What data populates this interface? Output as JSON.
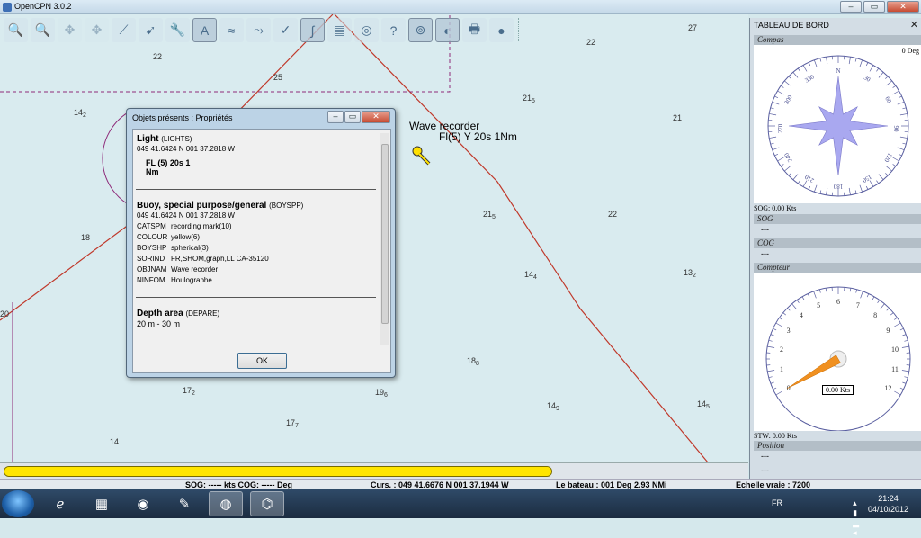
{
  "window": {
    "title": "OpenCPN 3.0.2"
  },
  "toolbar": {
    "tools": [
      {
        "name": "zoom-in-icon",
        "glyph": "🔍"
      },
      {
        "name": "zoom-out-icon",
        "glyph": "🔍"
      },
      {
        "name": "scale-in-icon",
        "glyph": "✥"
      },
      {
        "name": "scale-out-icon",
        "glyph": "✥"
      },
      {
        "name": "route-icon",
        "glyph": "⟋"
      },
      {
        "name": "follow-ship-icon",
        "glyph": "➹"
      },
      {
        "name": "settings-icon",
        "glyph": "🔧"
      },
      {
        "name": "text-icon",
        "glyph": "A"
      },
      {
        "name": "chart-tide-icon",
        "glyph": "≈"
      },
      {
        "name": "current-icon",
        "glyph": "⤳"
      },
      {
        "name": "quilt-icon",
        "glyph": "✓"
      },
      {
        "name": "track-icon",
        "glyph": "∫"
      },
      {
        "name": "layers-icon",
        "glyph": "▤"
      },
      {
        "name": "mob-icon",
        "glyph": "◎"
      },
      {
        "name": "help-icon",
        "glyph": "?"
      },
      {
        "name": "dashboard-icon",
        "glyph": "⊚"
      },
      {
        "name": "globe-icon",
        "glyph": "◐"
      },
      {
        "name": "print-icon",
        "glyph": "🖶"
      },
      {
        "name": "about-icon",
        "glyph": "●"
      }
    ]
  },
  "chart": {
    "soundings": [
      {
        "v": "22",
        "s": ""
      },
      {
        "v": "27",
        "s": ""
      },
      {
        "v": "22",
        "s": ""
      },
      {
        "v": "25",
        "s": ""
      },
      {
        "v": "21",
        "s": "5"
      },
      {
        "v": "14",
        "s": "2"
      },
      {
        "v": "21",
        "s": ""
      },
      {
        "v": "21",
        "s": "5"
      },
      {
        "v": "22",
        "s": ""
      },
      {
        "v": "18",
        "s": ""
      },
      {
        "v": "14",
        "s": "4"
      },
      {
        "v": "13",
        "s": "2"
      },
      {
        "v": "18",
        "s": "8"
      },
      {
        "v": "17",
        "s": "2"
      },
      {
        "v": "19",
        "s": "6"
      },
      {
        "v": "14",
        "s": "9"
      },
      {
        "v": "14",
        "s": "5"
      },
      {
        "v": "17",
        "s": "7"
      },
      {
        "v": "14",
        "s": ""
      },
      {
        "v": "20",
        "s": ""
      }
    ],
    "wave_label": "Wave recorder",
    "light_label": "Fl(5) Y 20s 1Nm"
  },
  "dialog": {
    "title": "Objets présents : Propriétés",
    "light": {
      "name": "Light",
      "code": "(LIGHTS)",
      "position": "049 41.6424 N 001 37.2818 W",
      "fl_line1": "FL (5) 20s 1",
      "fl_line2": "Nm"
    },
    "buoy": {
      "name": "Buoy, special purpose/general",
      "code": "(BOYSPP)",
      "position": "049 41.6424 N 001 37.2818 W",
      "attrs": [
        {
          "k": "CATSPM",
          "v": "recording mark(10)"
        },
        {
          "k": "COLOUR",
          "v": "yellow(6)"
        },
        {
          "k": "BOYSHP",
          "v": "spherical(3)"
        },
        {
          "k": "SORIND",
          "v": "FR,SHOM,graph,LL CA-35120"
        },
        {
          "k": "OBJNAM",
          "v": "Wave recorder"
        },
        {
          "k": "NINFOM",
          "v": "Houlographe"
        }
      ]
    },
    "depth": {
      "name": "Depth area",
      "code": "(DEPARE)",
      "range": "20 m - 30 m"
    },
    "ok_label": "OK"
  },
  "dashboard": {
    "title": "TABLEAU DE BORD",
    "compass": {
      "label": "Compas",
      "heading": "0 Deg",
      "sog": "SOG: 0.00 Kts",
      "ticks": [
        "N",
        "30",
        "60",
        "90",
        "120",
        "150",
        "180",
        "210",
        "240",
        "270",
        "300",
        "330"
      ]
    },
    "sog": {
      "label": "SOG",
      "value": "---"
    },
    "cog": {
      "label": "COG",
      "value": "---"
    },
    "counter": {
      "label": "Compteur",
      "readout": "0.00 Kts",
      "stw": "STW: 0.00 Kts",
      "ticks": [
        "0",
        "1",
        "2",
        "3",
        "4",
        "5",
        "6",
        "7",
        "8",
        "9",
        "10",
        "11",
        "12"
      ],
      "needle_value": 0
    },
    "position": {
      "label": "Position",
      "lat": "---",
      "lon": "---"
    }
  },
  "statusbar": {
    "progress": 1.0
  },
  "infobar": {
    "sog_cog": "SOG: ----- kts  COG: ----- Deg",
    "cursor": "Curs. : 049 41.6676 N 001 37.1944 W",
    "boat": "Le bateau : 001 Deg    2.93 NMi",
    "scale": "Echelle vraie :   7200"
  },
  "taskbar": {
    "lang": "FR",
    "time": "21:24",
    "date": "04/10/2012"
  }
}
